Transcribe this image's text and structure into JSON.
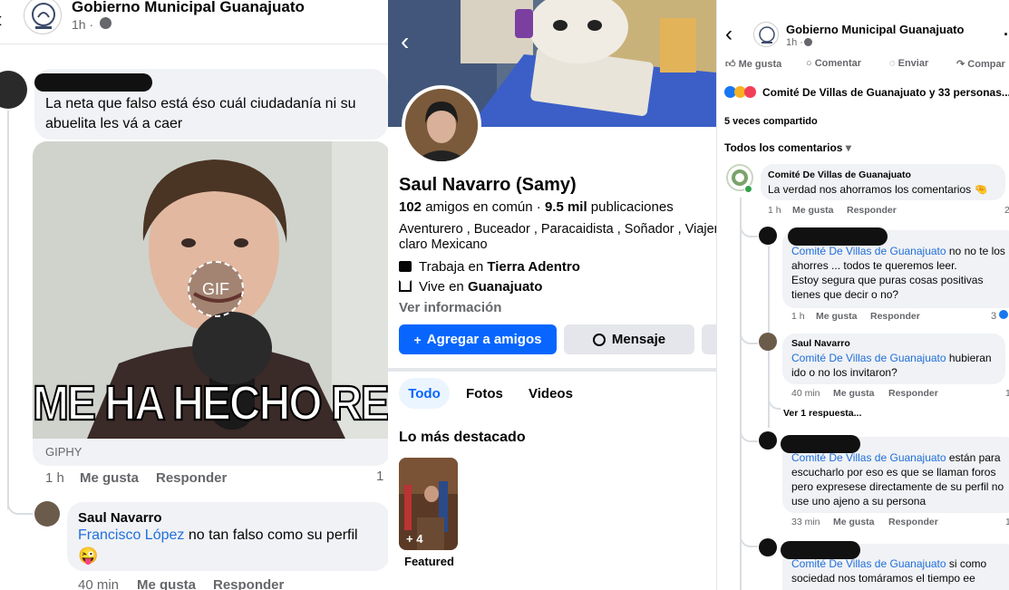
{
  "left": {
    "header": {
      "page_name": "Gobierno Municipal Guanajuato",
      "time": "1h ·"
    },
    "comment1": {
      "text_line1": "La neta que falso está éso cuál ciudadanía ni su",
      "text_line2": "abuelita les vá a caer"
    },
    "gif": {
      "caption": "ME HA HECHO REIR",
      "badge": "GIF",
      "source": "GIPHY"
    },
    "comment1_actions": {
      "time": "1 h",
      "like": "Me gusta",
      "reply": "Responder",
      "count": "1"
    },
    "reply": {
      "author": "Saul Navarro",
      "mention": "Francisco López",
      "text": " no tan falso como su perfil",
      "emoji": "😜"
    },
    "reply_actions": {
      "time": "40 min",
      "like": "Me gusta",
      "reply": "Responder"
    }
  },
  "middle": {
    "name": "Saul Navarro (Samy)",
    "friends_count": "102",
    "friends_text": " amigos en común · ",
    "posts_count": "9.5 mil",
    "posts_text": " publicaciones",
    "bio_line1": "Aventurero , Buceador , Paracaidista , Soñador , Viajero",
    "bio_line2": "claro Mexicano",
    "work_prefix": "Trabaja en ",
    "work_place": "Tierra Adentro",
    "live_prefix": "Vive en ",
    "live_place": "Guanajuato",
    "see_info": "Ver información",
    "add_friend": "Agregar a amigos",
    "message": "Mensaje",
    "tabs": [
      "Todo",
      "Fotos",
      "Videos"
    ],
    "highlights_title": "Lo más destacado",
    "featured_count": "+ 4",
    "featured_label": "Featured"
  },
  "right": {
    "header": {
      "page_name": "Gobierno Municipal Guanajuato",
      "time": "1h ·"
    },
    "actions": {
      "like": "Me gusta",
      "comment": "Comentar",
      "send": "Enviar",
      "share": "Compar"
    },
    "reactions_text": "Comité De Villas de Guanajuato y 33 personas...",
    "shares": "5 veces compartido",
    "sort": "Todos los comentarios",
    "c1": {
      "author": "Comité De Villas de Guanajuato",
      "text": "La verdad nos ahorramos los comentarios 🤏",
      "time": "1 h",
      "like": "Me gusta",
      "reply": "Responder",
      "count": "2"
    },
    "r1": {
      "mention": "Comité De Villas de Guanajuato",
      "text_a": " no no te los",
      "line2": "ahorres ... todos te queremos leer.",
      "line3": "Estoy segura que puras cosas positivas",
      "line4": "tienes que decir o no?",
      "time": "1 h",
      "like": "Me gusta",
      "reply": "Responder",
      "count": "3"
    },
    "r2": {
      "author": "Saul Navarro",
      "mention": "Comité De Villas de Guanajuato",
      "text_a": " hubieran",
      "line2": "ido o no los invitaron?",
      "time": "40 min",
      "like": "Me gusta",
      "reply": "Responder",
      "count": "1",
      "more": "Ver 1 respuesta..."
    },
    "r3": {
      "mention": "Comité De Villas de Guanajuato",
      "text_a": "  están para",
      "line2": "escucharlo por eso es que se llaman foros",
      "line3": "pero expresese directamente de su perfil no",
      "line4": "use uno ajeno a su persona",
      "time": "33 min",
      "like": "Me gusta",
      "reply": "Responder",
      "count": "1"
    },
    "r4": {
      "mention": "Comité De Villas de Guanajuato",
      "text_a": "  si como",
      "line2": "sociedad nos tomáramos el tiempo ee"
    }
  }
}
